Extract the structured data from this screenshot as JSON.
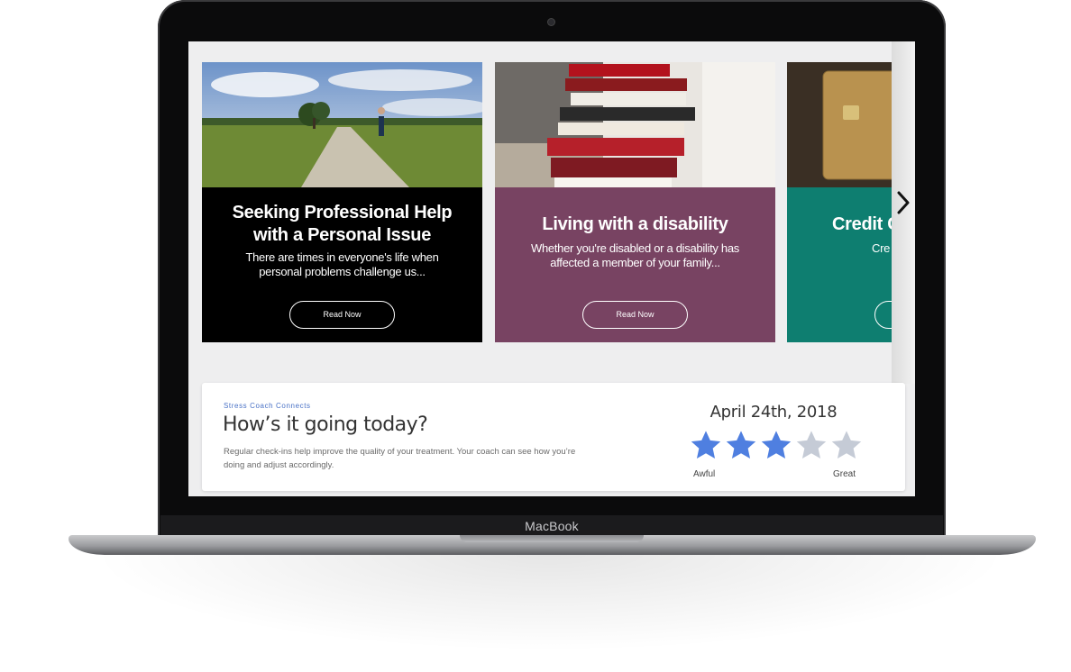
{
  "device": {
    "brand_label": "MacBook"
  },
  "articles": [
    {
      "title": "Seeking Professional Help with a Personal Issue",
      "excerpt": "There are times in everyone's life when personal problems challenge us...",
      "button_label": "Read Now",
      "color": "#000000"
    },
    {
      "title": "Living with a disability",
      "excerpt": "Whether you're disabled or a disability has affected a member of your family...",
      "button_label": "Read Now",
      "color": "#784362"
    },
    {
      "title": "Credit C",
      "excerpt": "Cre",
      "color": "#0e7e70"
    }
  ],
  "checkin": {
    "kicker": "Stress Coach Connects",
    "question": "How’s it going today?",
    "description": "Regular check-ins help improve the quality of your treatment. Your coach can see how you’re doing and adjust accordingly.",
    "date": "April 24th, 2018",
    "rating": 3,
    "rating_max": 5,
    "scale_low_label": "Awful",
    "scale_high_label": "Great",
    "star_active_color": "#4f7fe0",
    "star_inactive_color": "#c5cbd6"
  },
  "icons": {
    "next": "chevron-right-icon",
    "rating": "star-icon"
  }
}
